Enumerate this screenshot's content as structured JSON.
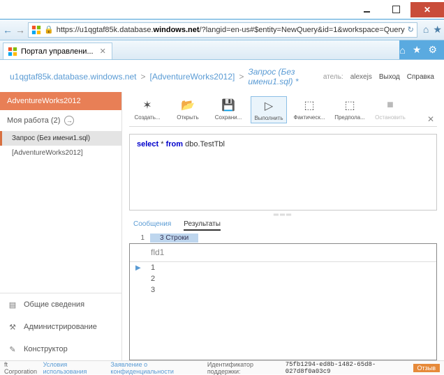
{
  "window": {
    "url_prefix": "https://u1qgtaf85k.database.",
    "url_host": "windows.net",
    "url_suffix": "/?langid=en-us#$entity=NewQuery&id=1&workspace=Query",
    "tab_title": "Портал управлени..."
  },
  "header": {
    "bc_host": "u1qgtaf85k.database.windows.net",
    "bc_db": "[AdventureWorks2012]",
    "bc_query": "Запрос (Без имени1.sql) *",
    "user_label": "атель:",
    "user_name": "alexejs",
    "logout": "Выход",
    "help": "Справка"
  },
  "sidebar": {
    "title": "AdventureWorks2012",
    "work_label": "Моя работа (2)",
    "items": [
      {
        "label": "Запрос (Без имени1.sql)",
        "active": true
      },
      {
        "label": "[AdventureWorks2012]",
        "active": false
      }
    ],
    "bottom": [
      {
        "label": "Общие сведения",
        "icon": "overview"
      },
      {
        "label": "Администрирование",
        "icon": "admin"
      },
      {
        "label": "Конструктор",
        "icon": "designer"
      }
    ]
  },
  "toolbar": {
    "items": [
      {
        "key": "create",
        "label": "Создать...",
        "glyph": "✶"
      },
      {
        "key": "open",
        "label": "Открыть",
        "glyph": "📂"
      },
      {
        "key": "save",
        "label": "Сохрани...",
        "glyph": "💾"
      },
      {
        "key": "run",
        "label": "Выполнить",
        "glyph": "▷",
        "selected": true
      },
      {
        "key": "actual",
        "label": "Фактическ...",
        "glyph": "⬚"
      },
      {
        "key": "estim",
        "label": "Предпола...",
        "glyph": "⬚"
      },
      {
        "key": "stop",
        "label": "Остановить",
        "glyph": "■",
        "disabled": true
      }
    ]
  },
  "editor": {
    "kw1": "select",
    "star": " * ",
    "kw2": "from",
    "rest": " dbo.TestTbl"
  },
  "results": {
    "tab_messages": "Сообщения",
    "tab_results": "Результаты",
    "rowcount_num": "1",
    "rowcount_text": "3  Строки",
    "column": "fld1",
    "rows": [
      "1",
      "2",
      "3"
    ]
  },
  "footer": {
    "corp": "ft Corporation",
    "terms": "Условия использования",
    "privacy": "Заявление о конфиденциальности",
    "support_label": "Идентификатор поддержки:",
    "support_id": "75fb1294-ed8b-1482-65d8-027d8f0a03c9",
    "feedback": "Отзыв"
  }
}
